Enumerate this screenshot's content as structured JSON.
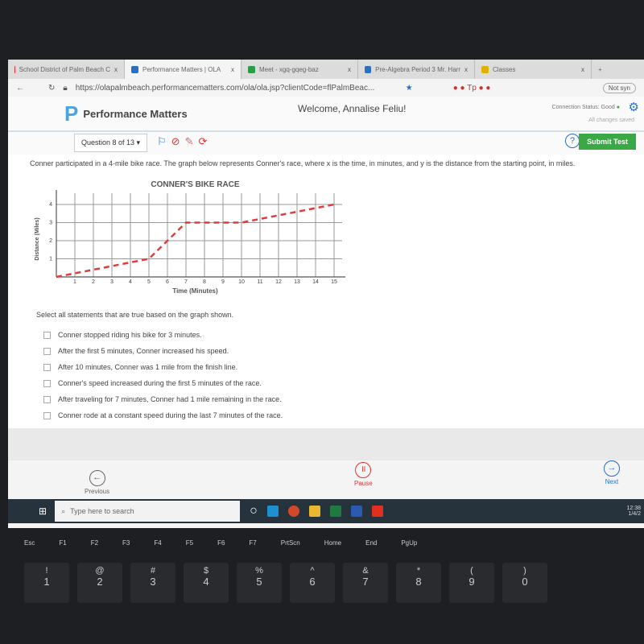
{
  "browser": {
    "tabs": [
      {
        "label": "School District of Palm Beach C",
        "color": "#d33"
      },
      {
        "label": "Performance Matters | OLA",
        "color": "#2a6fc0",
        "active": true
      },
      {
        "label": "Meet - xgq-gqeg-baz",
        "color": "#2a9d4a"
      },
      {
        "label": "Pre-Algebra Period 3 Mr. Harr",
        "color": "#2a6fc0"
      },
      {
        "label": "Classes",
        "color": "#e0b000"
      }
    ],
    "close_glyph": "x",
    "new_tab": "+",
    "url": "https://olapalmbeach.performancematters.com/ola/ola.jsp?clientCode=flPalmBeac...",
    "profile": "Not syn"
  },
  "header": {
    "logo": "Performance Matters",
    "welcome": "Welcome, Annalise Feliu!",
    "connection": "Connection Status: Good",
    "saved": "All changes saved"
  },
  "toolbar": {
    "question": "Question 8 of 13 ▾",
    "help": "?",
    "submit": "Submit Test"
  },
  "question": {
    "text": "Conner participated in a 4-mile bike race.  The graph below represents Conner's race, where x is the time, in minutes, and y is the distance from the starting point, in miles.",
    "prompt": "Select all statements that are true based on the graph shown.",
    "options": [
      "Conner stopped riding his bike for 3 minutes.",
      "After the first 5 minutes, Conner increased his speed.",
      "After 10 minutes, Conner was 1 mile from the finish line.",
      "Conner's speed increased during the first 5 minutes of the race.",
      "After traveling for 7 minutes, Conner had 1 mile remaining in the race.",
      "Conner rode at a constant speed during the last 7 minutes of the race."
    ]
  },
  "chart_data": {
    "type": "line",
    "title": "CONNER'S BIKE RACE",
    "xlabel": "Time (Minutes)",
    "ylabel": "Distance (Miles)",
    "xlim": [
      0,
      15
    ],
    "ylim": [
      0,
      4
    ],
    "xticks": [
      1,
      2,
      3,
      4,
      5,
      6,
      7,
      8,
      9,
      10,
      11,
      12,
      13,
      14,
      15
    ],
    "yticks": [
      1,
      2,
      3,
      4
    ],
    "grid": true,
    "line_style": "dashed",
    "color": "#e03c3c",
    "x": [
      0,
      5,
      7,
      10,
      15
    ],
    "y": [
      0,
      1,
      3,
      3,
      4
    ]
  },
  "footer": {
    "previous": "Previous",
    "pause": "Pause",
    "next": "Next"
  },
  "taskbar": {
    "search": "Type here to search",
    "time": "12:38",
    "date": "1/4/2"
  },
  "keyboard": {
    "fkeys": [
      "Esc",
      "F1",
      "F2",
      "F3",
      "F4",
      "F5",
      "F6",
      "F7",
      "PrtScn",
      "Home",
      "End",
      "PgUp"
    ],
    "numbers": [
      [
        "!",
        "1"
      ],
      [
        "@",
        "2"
      ],
      [
        "#",
        "3"
      ],
      [
        "$",
        "4"
      ],
      [
        "%",
        "5"
      ],
      [
        "^",
        "6"
      ],
      [
        "&",
        "7"
      ],
      [
        "*",
        "8"
      ],
      [
        "(",
        "9"
      ],
      [
        ")",
        "0"
      ]
    ]
  }
}
